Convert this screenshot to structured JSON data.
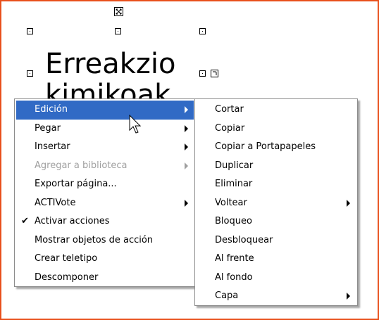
{
  "canvas": {
    "text_line1": "Erreakzio",
    "text_line2": "kimikoak"
  },
  "context_menu": {
    "items": [
      {
        "label": "Edición",
        "submenu": true,
        "state": "highlighted"
      },
      {
        "label": "Pegar",
        "submenu": true
      },
      {
        "label": "Insertar",
        "submenu": true
      },
      {
        "label": "Agregar a biblioteca",
        "submenu": true,
        "state": "disabled"
      },
      {
        "label": "Exportar página...",
        "submenu": false
      },
      {
        "label": "ACTIVote",
        "submenu": true
      },
      {
        "label": "Activar acciones",
        "submenu": false,
        "checked": true,
        "check_glyph": "✔"
      },
      {
        "label": "Mostrar objetos de acción",
        "submenu": false
      },
      {
        "label": "Crear teletipo",
        "submenu": false
      },
      {
        "label": "Descomponer",
        "submenu": false
      }
    ]
  },
  "submenu": {
    "items": [
      {
        "label": "Cortar",
        "submenu": false
      },
      {
        "label": "Copiar",
        "submenu": false
      },
      {
        "label": "Copiar a Portapapeles",
        "submenu": false
      },
      {
        "label": "Duplicar",
        "submenu": false
      },
      {
        "label": "Eliminar",
        "submenu": false
      },
      {
        "label": "Voltear",
        "submenu": true
      },
      {
        "label": "Bloqueo",
        "submenu": false
      },
      {
        "label": "Desbloquear",
        "submenu": false
      },
      {
        "label": "Al frente",
        "submenu": false
      },
      {
        "label": "Al fondo",
        "submenu": false
      },
      {
        "label": "Capa",
        "submenu": true
      }
    ]
  },
  "colors": {
    "highlight": "#316ac5",
    "frame_border": "#e8501c"
  },
  "icons": [
    "rotate-handle-icon",
    "skew-handle-icon",
    "selection-handle-icon",
    "arrow-cursor-icon",
    "checkmark-icon",
    "submenu-arrow-icon"
  ]
}
